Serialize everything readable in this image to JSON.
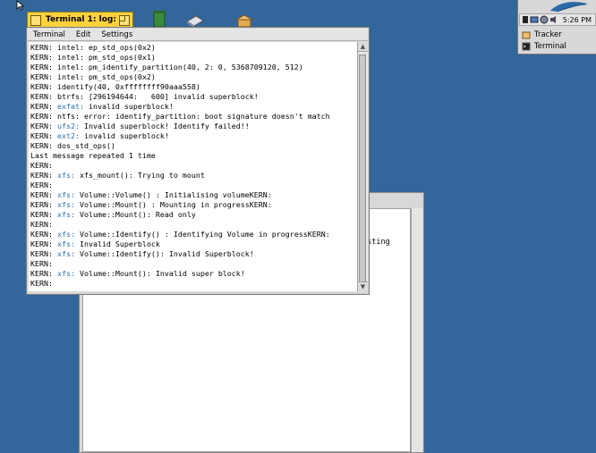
{
  "terminal": {
    "title": "Terminal 1: log: --",
    "menu": [
      "Terminal",
      "Edit",
      "Settings"
    ],
    "lines": [
      [
        {
          "t": "KERN: intel: ep_std_ops(0x2)"
        }
      ],
      [
        {
          "t": "KERN: intel: pm_std_ops(0x1)"
        }
      ],
      [
        {
          "t": "KERN: intel: pm_identify_partition(40, 2: 0, 5368709120, 512)"
        }
      ],
      [
        {
          "t": "KERN: intel: pm_std_ops(0x2)"
        }
      ],
      [
        {
          "t": "KERN: identify(40, 0xffffffff90aaa558)"
        }
      ],
      [
        {
          "t": "KERN: btrfs: [296194644:   600] invalid superblock!"
        }
      ],
      [
        {
          "t": "KERN: "
        },
        {
          "t": "exfat:",
          "c": "kw"
        },
        {
          "t": " invalid superblock!"
        }
      ],
      [
        {
          "t": "KERN: ntfs: error: identify_partition: boot signature doesn't match"
        }
      ],
      [
        {
          "t": "KERN: "
        },
        {
          "t": "ufs2:",
          "c": "kw"
        },
        {
          "t": " Invalid superblock! Identify failed!!"
        }
      ],
      [
        {
          "t": "KERN: "
        },
        {
          "t": "ext2:",
          "c": "kw"
        },
        {
          "t": " invalid superblock!"
        }
      ],
      [
        {
          "t": "KERN: dos_std_ops()"
        }
      ],
      [
        {
          "t": "Last message repeated 1 time"
        }
      ],
      [
        {
          "t": "KERN:"
        }
      ],
      [
        {
          "t": "KERN: "
        },
        {
          "t": "xfs:",
          "c": "kw"
        },
        {
          "t": " xfs_mount(): Trying to mount"
        }
      ],
      [
        {
          "t": "KERN:"
        }
      ],
      [
        {
          "t": "KERN: "
        },
        {
          "t": "xfs:",
          "c": "kw"
        },
        {
          "t": " Volume::Volume() : Initialising volumeKERN:"
        }
      ],
      [
        {
          "t": "KERN: "
        },
        {
          "t": "xfs:",
          "c": "kw"
        },
        {
          "t": " Volume::Mount() : Mounting in progressKERN:"
        }
      ],
      [
        {
          "t": "KERN: "
        },
        {
          "t": "xfs:",
          "c": "kw"
        },
        {
          "t": " Volume::Mount(): Read only"
        }
      ],
      [
        {
          "t": "KERN:"
        }
      ],
      [
        {
          "t": "KERN: "
        },
        {
          "t": "xfs:",
          "c": "kw"
        },
        {
          "t": " Volume::Identify() : Identifying Volume in progressKERN:"
        }
      ],
      [
        {
          "t": "KERN: "
        },
        {
          "t": "xfs:",
          "c": "kw"
        },
        {
          "t": " Invalid Superblock"
        }
      ],
      [
        {
          "t": "KERN: "
        },
        {
          "t": "xfs:",
          "c": "kw"
        },
        {
          "t": " Volume::Identify(): Invalid Superblock!"
        }
      ],
      [
        {
          "t": "KERN:"
        }
      ],
      [
        {
          "t": "KERN: "
        },
        {
          "t": "xfs:",
          "c": "kw"
        },
        {
          "t": " Volume::Mount(): Invalid super block!"
        }
      ],
      [
        {
          "t": "KERN:"
        }
      ]
    ]
  },
  "background_window": {
    "partial_text": "esting"
  },
  "deskbar": {
    "clock": "5:26 PM",
    "items": [
      {
        "label": "Tracker",
        "icon": "tracker-icon"
      },
      {
        "label": "Terminal",
        "icon": "terminal-icon"
      }
    ]
  },
  "colors": {
    "desktop": "#33669a",
    "tab_yellow": "#ffd23c",
    "keyword_blue": "#2a6fb8"
  }
}
